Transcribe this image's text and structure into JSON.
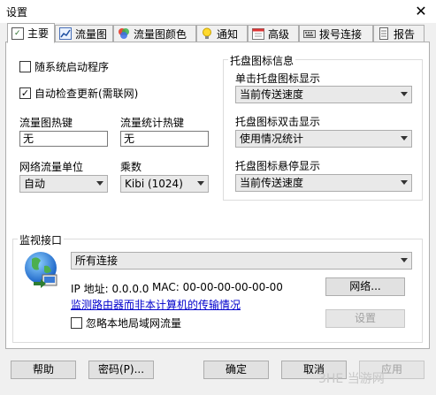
{
  "window": {
    "title": "设置"
  },
  "tabs": [
    {
      "label": "主要",
      "icon": "doc-check-icon"
    },
    {
      "label": "流量图",
      "icon": "chart-icon"
    },
    {
      "label": "流量图颜色",
      "icon": "palette-icon"
    },
    {
      "label": "通知",
      "icon": "lightbulb-icon"
    },
    {
      "label": "高级",
      "icon": "calendar-icon"
    },
    {
      "label": "拨号连接",
      "icon": "keyboard-icon"
    },
    {
      "label": "报告",
      "icon": "report-icon"
    }
  ],
  "main": {
    "startup_label": "随系统启动程序",
    "startup_checked": false,
    "autoupdate_label": "自动检查更新(需联网)",
    "autoupdate_checked": true,
    "graph_hotkey_label": "流量图热键",
    "graph_hotkey_value": "无",
    "stats_hotkey_label": "流量统计热键",
    "stats_hotkey_value": "无",
    "unit_label": "网络流量单位",
    "unit_value": "自动",
    "multiplier_label": "乘数",
    "multiplier_value": "Kibi (1024)"
  },
  "tray": {
    "group_title": "托盘图标信息",
    "single_click_label": "单击托盘图标显示",
    "single_click_value": "当前传送速度",
    "double_click_label": "托盘图标双击显示",
    "double_click_value": "使用情况统计",
    "hover_label": "托盘图标悬停显示",
    "hover_value": "当前传送速度"
  },
  "monitor": {
    "group_title": "监视接口",
    "interface_value": "所有连接",
    "ip_text": "IP 地址: 0.0.0.0",
    "mac_text": "MAC: 00-00-00-00-00-00",
    "network_button": "网络...",
    "router_link": "监测路由器而非本计算机的传输情况",
    "settings_button": "设置",
    "ignore_lan_label": "忽略本地局域网流量",
    "ignore_lan_checked": false
  },
  "footer": {
    "help": "帮助",
    "password": "密码(P)...",
    "ok": "确定",
    "cancel": "取消",
    "apply": "应用"
  },
  "watermark": "3HE 当游网"
}
